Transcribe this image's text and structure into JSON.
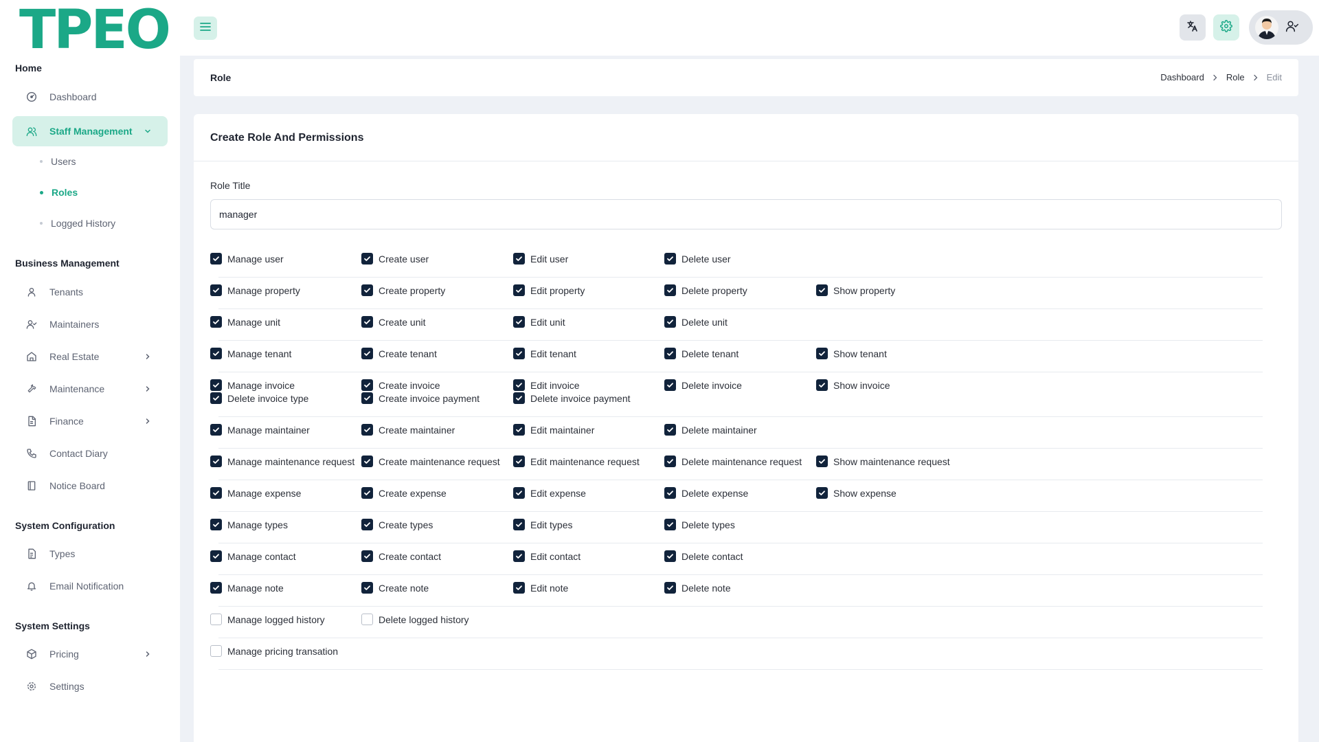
{
  "app": {
    "logo_text": "TPEO",
    "accent_color": "#1ba887",
    "checkbox_color": "#11233b"
  },
  "header": {
    "menu_icon": "hamburger-icon",
    "translate_icon": "translate-icon",
    "settings_icon": "gear-icon",
    "user_icon": "user-check-icon"
  },
  "sidebar": {
    "sections": [
      {
        "title": "Home",
        "items": [
          {
            "label": "Dashboard",
            "icon": "dashboard-icon"
          },
          {
            "label": "Staff Management",
            "icon": "users-icon",
            "active": true,
            "expanded": true,
            "children": [
              {
                "label": "Users"
              },
              {
                "label": "Roles",
                "active": true
              },
              {
                "label": "Logged History"
              }
            ]
          }
        ]
      },
      {
        "title": "Business Management",
        "items": [
          {
            "label": "Tenants",
            "icon": "user-icon"
          },
          {
            "label": "Maintainers",
            "icon": "user-check-icon"
          },
          {
            "label": "Real Estate",
            "icon": "home-icon",
            "has_children": true
          },
          {
            "label": "Maintenance",
            "icon": "tool-icon",
            "has_children": true
          },
          {
            "label": "Finance",
            "icon": "file-icon",
            "has_children": true
          },
          {
            "label": "Contact Diary",
            "icon": "phone-icon"
          },
          {
            "label": "Notice Board",
            "icon": "board-icon"
          }
        ]
      },
      {
        "title": "System Configuration",
        "items": [
          {
            "label": "Types",
            "icon": "file-text-icon"
          },
          {
            "label": "Email Notification",
            "icon": "bell-icon"
          }
        ]
      },
      {
        "title": "System Settings",
        "items": [
          {
            "label": "Pricing",
            "icon": "package-icon",
            "has_children": true
          },
          {
            "label": "Settings",
            "icon": "gear-icon"
          }
        ]
      }
    ]
  },
  "page": {
    "title": "Role",
    "breadcrumb": [
      "Dashboard",
      "Role",
      "Edit"
    ]
  },
  "form": {
    "title": "Create Role And Permissions",
    "role_title_label": "Role Title",
    "role_title_value": "manager",
    "permission_rows": [
      {
        "items": [
          {
            "label": "Manage user",
            "checked": true
          },
          {
            "label": "Create user",
            "checked": true
          },
          {
            "label": "Edit user",
            "checked": true
          },
          {
            "label": "Delete user",
            "checked": true
          }
        ]
      },
      {
        "items": [
          {
            "label": "Manage property",
            "checked": true
          },
          {
            "label": "Create property",
            "checked": true
          },
          {
            "label": "Edit property",
            "checked": true
          },
          {
            "label": "Delete property",
            "checked": true
          },
          {
            "label": "Show property",
            "checked": true
          }
        ]
      },
      {
        "items": [
          {
            "label": "Manage unit",
            "checked": true
          },
          {
            "label": "Create unit",
            "checked": true
          },
          {
            "label": "Edit unit",
            "checked": true
          },
          {
            "label": "Delete unit",
            "checked": true
          }
        ]
      },
      {
        "items": [
          {
            "label": "Manage tenant",
            "checked": true
          },
          {
            "label": "Create tenant",
            "checked": true
          },
          {
            "label": "Edit tenant",
            "checked": true
          },
          {
            "label": "Delete tenant",
            "checked": true
          },
          {
            "label": "Show tenant",
            "checked": true
          }
        ]
      },
      {
        "items": [
          {
            "label": "Manage invoice",
            "checked": true
          },
          {
            "label": "Create invoice",
            "checked": true
          },
          {
            "label": "Edit invoice",
            "checked": true
          },
          {
            "label": "Delete invoice",
            "checked": true
          },
          {
            "label": "Show invoice",
            "checked": true
          },
          {
            "label": "Delete invoice type",
            "checked": true
          },
          {
            "label": "Create invoice payment",
            "checked": true
          },
          {
            "label": "Delete invoice payment",
            "checked": true
          }
        ]
      },
      {
        "items": [
          {
            "label": "Manage maintainer",
            "checked": true
          },
          {
            "label": "Create maintainer",
            "checked": true
          },
          {
            "label": "Edit maintainer",
            "checked": true
          },
          {
            "label": "Delete maintainer",
            "checked": true
          }
        ]
      },
      {
        "items": [
          {
            "label": "Manage maintenance request",
            "checked": true
          },
          {
            "label": "Create maintenance request",
            "checked": true
          },
          {
            "label": "Edit maintenance request",
            "checked": true
          },
          {
            "label": "Delete maintenance request",
            "checked": true
          },
          {
            "label": "Show maintenance request",
            "checked": true
          }
        ]
      },
      {
        "items": [
          {
            "label": "Manage expense",
            "checked": true
          },
          {
            "label": "Create expense",
            "checked": true
          },
          {
            "label": "Edit expense",
            "checked": true
          },
          {
            "label": "Delete expense",
            "checked": true
          },
          {
            "label": "Show expense",
            "checked": true
          }
        ]
      },
      {
        "items": [
          {
            "label": "Manage types",
            "checked": true
          },
          {
            "label": "Create types",
            "checked": true
          },
          {
            "label": "Edit types",
            "checked": true
          },
          {
            "label": "Delete types",
            "checked": true
          }
        ]
      },
      {
        "items": [
          {
            "label": "Manage contact",
            "checked": true
          },
          {
            "label": "Create contact",
            "checked": true
          },
          {
            "label": "Edit contact",
            "checked": true
          },
          {
            "label": "Delete contact",
            "checked": true
          }
        ]
      },
      {
        "items": [
          {
            "label": "Manage note",
            "checked": true
          },
          {
            "label": "Create note",
            "checked": true
          },
          {
            "label": "Edit note",
            "checked": true
          },
          {
            "label": "Delete note",
            "checked": true
          }
        ]
      },
      {
        "items": [
          {
            "label": "Manage logged history",
            "checked": false
          },
          {
            "label": "Delete logged history",
            "checked": false
          }
        ]
      },
      {
        "items": [
          {
            "label": "Manage pricing transation",
            "checked": false
          }
        ]
      }
    ]
  }
}
